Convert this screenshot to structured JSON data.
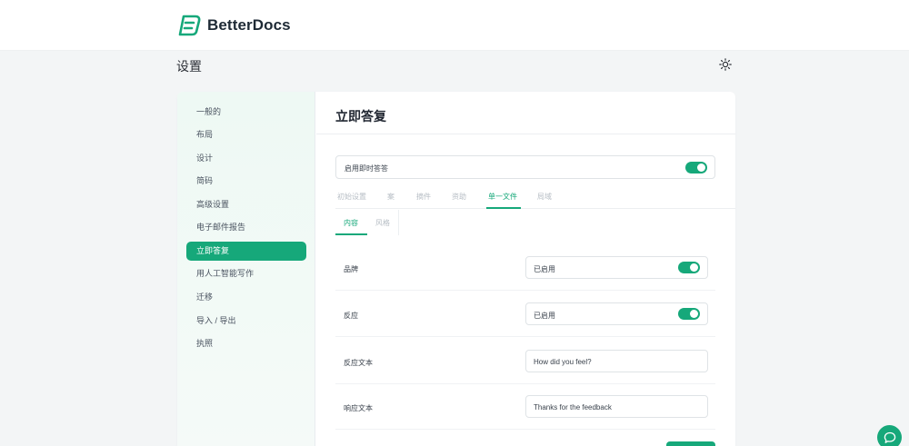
{
  "brand": {
    "name": "BetterDocs",
    "accent": "#16a87a"
  },
  "page": {
    "title": "设置"
  },
  "sidebar": {
    "items": [
      {
        "label": "一般的"
      },
      {
        "label": "布局"
      },
      {
        "label": "设计"
      },
      {
        "label": "简码"
      },
      {
        "label": "高级设置"
      },
      {
        "label": "电子邮件报告"
      },
      {
        "label": "立即答复",
        "active": true
      },
      {
        "label": "用人工智能写作"
      },
      {
        "label": "迁移"
      },
      {
        "label": "导入 / 导出"
      },
      {
        "label": "执照"
      }
    ]
  },
  "main": {
    "title": "立即答复",
    "enable": {
      "label": "启用即时答答",
      "on": true
    },
    "tabs": [
      {
        "label": "初始设置"
      },
      {
        "label": "案"
      },
      {
        "label": "摘件"
      },
      {
        "label": "资助"
      },
      {
        "label": "单一文件",
        "active": true
      },
      {
        "label": "局域"
      }
    ],
    "subtabs": [
      {
        "label": "内容",
        "active": true
      },
      {
        "label": "风格"
      }
    ],
    "fields": [
      {
        "label": "品牌",
        "value": "已启用",
        "type": "toggle",
        "on": true
      },
      {
        "label": "反应",
        "value": "已启用",
        "type": "toggle",
        "on": true
      },
      {
        "label": "反应文本",
        "value": "How did you feel?",
        "type": "text"
      },
      {
        "label": "响应文本",
        "value": "Thanks for the feedback",
        "type": "text"
      }
    ]
  },
  "icons": {
    "theme": "sun-icon",
    "chat": "chat-bubble-icon",
    "logo": "betterdocs-logo-icon"
  }
}
